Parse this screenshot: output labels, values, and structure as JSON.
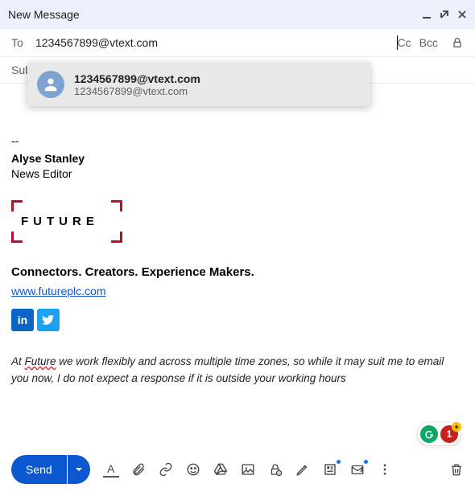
{
  "header": {
    "title": "New Message"
  },
  "to": {
    "label": "To",
    "value": "1234567899@vtext.com",
    "cc": "Cc",
    "bcc": "Bcc"
  },
  "autocomplete": {
    "main": "1234567899@vtext.com",
    "sub": "1234567899@vtext.com"
  },
  "subject": {
    "label": "Subject"
  },
  "signature": {
    "sep": "--",
    "name": "Alyse Stanley",
    "role": "News Editor",
    "logo_text": "FUTURE",
    "tagline": "Connectors. Creators. Experience Makers.",
    "url": "www.futureplc.com"
  },
  "note": {
    "pre": "At ",
    "word": "Future",
    "post": " we work flexibly and across multiple time zones, so while it may suit me to email you now, I do not expect a response if it is outside your working hours"
  },
  "badges": {
    "count": "1",
    "plus": "+"
  },
  "toolbar": {
    "send": "Send",
    "format_A": "A"
  }
}
